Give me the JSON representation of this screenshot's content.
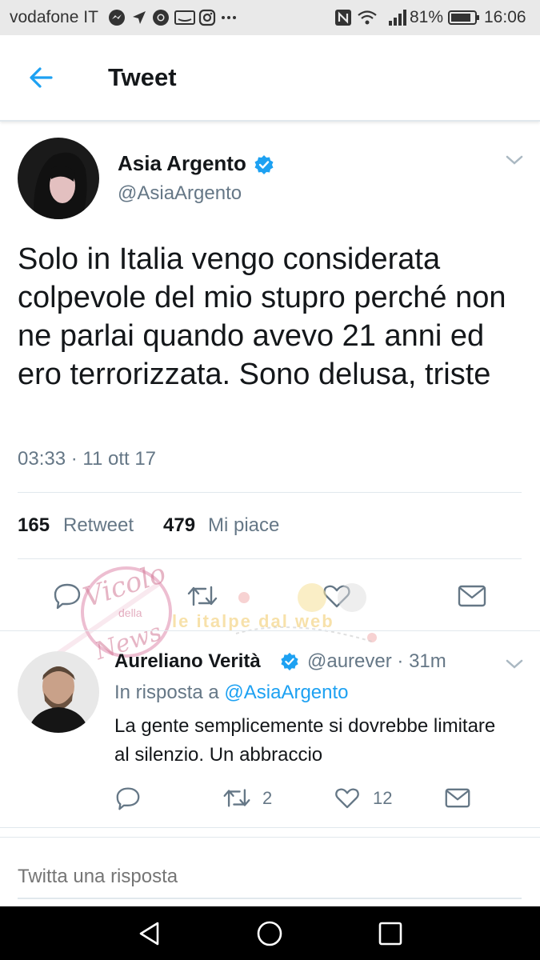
{
  "status_bar": {
    "carrier": "vodafone IT",
    "battery": "81%",
    "time": "16:06",
    "icons": [
      "messenger-icon",
      "location-icon",
      "chrome-icon",
      "amazon-icon",
      "instagram-icon",
      "more-icon",
      "nfc-icon",
      "wifi-icon",
      "signal-icon",
      "battery-icon"
    ]
  },
  "header": {
    "title": "Tweet",
    "back_icon": "arrow-left-icon"
  },
  "tweet": {
    "author_name": "Asia Argento",
    "author_handle": "@AsiaArgento",
    "text": "Solo in Italia vengo considerata colpevole del mio stupro perché non ne parlai quando avevo 21 anni ed ero terrorizzata. Sono delusa, triste",
    "timestamp": "03:33 · 11 ott 17",
    "retweet_count": "165",
    "retweet_label": "Retweet",
    "like_count": "479",
    "like_label": "Mi piace"
  },
  "watermark": {
    "text_left": "Vicolo",
    "text_left_small": "della",
    "text_left_bottom": "News",
    "text_right": "le italpe dal web"
  },
  "reply": {
    "author_name": "Aureliano Verità",
    "author_handle": "@aurever · 31m",
    "context_prefix": "In risposta a",
    "context_mention": "@AsiaArgento",
    "text": "La gente semplicemente si dovrebbe limitare al silenzio. Un abbraccio",
    "retweets": "2",
    "likes": "12"
  },
  "compose": {
    "placeholder": "Twitta una risposta"
  },
  "colors": {
    "accent": "#1da1f2",
    "verified": "#1da1f2",
    "secondary_text": "#657786",
    "divider": "#e1e8ed"
  }
}
